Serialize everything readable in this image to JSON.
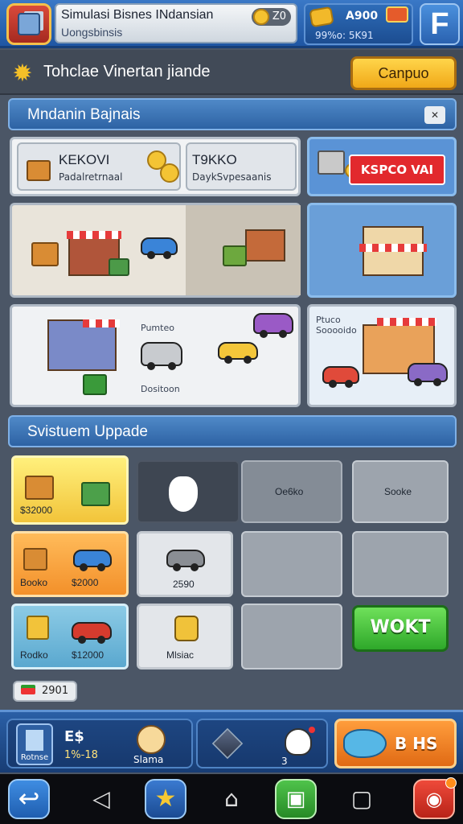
{
  "header": {
    "title": "Simulasi Bisnes INdansian",
    "subtitle": "Uongsbinsis",
    "level_value": "Z0",
    "currency_primary": "A900",
    "currency_secondary": "99%o: 5K91",
    "fb_label": "F"
  },
  "section": {
    "title": "Tohclae Vinertan jiande",
    "action_label": "Canpuo"
  },
  "business_banner": {
    "title": "Mndanin Bajnais"
  },
  "stats": [
    {
      "title": "KEKOVI",
      "sub": "Padalretrnaal"
    },
    {
      "title": "T9KKO",
      "sub": "DaykSvpesaanis"
    }
  ],
  "sale_tag": "KSPCO VAI",
  "scene_captions": [
    "Pumteo",
    "Dositoon",
    "Ptuco Sooooido"
  ],
  "upgrade_banner": {
    "title": "Svistuem Uppade"
  },
  "grid": {
    "r1": [
      "$32000",
      "",
      "Oe6ko",
      "Sooke"
    ],
    "r2": [
      "Booko",
      "$2000",
      "2590"
    ],
    "r3": [
      "Rodko",
      "$12000",
      "Mlsiac"
    ],
    "work_button": "WOKT"
  },
  "small_badge": "2901",
  "gamebar": {
    "tablet_label": "Rotnse",
    "left_value": "E$",
    "left_sub": "1%-18",
    "face_label": "Slama",
    "mid_value": "3",
    "right_value": "B HS"
  },
  "navbar": {
    "back": "↩",
    "soft_back": "◁",
    "star": "★",
    "home": "⌂",
    "green": "▣",
    "recent": "▢",
    "red": "◉"
  },
  "colors": {
    "accent_blue": "#2d62a4",
    "accent_yellow": "#f0a818",
    "accent_green": "#2ea82a",
    "sale_red": "#e2292d"
  }
}
